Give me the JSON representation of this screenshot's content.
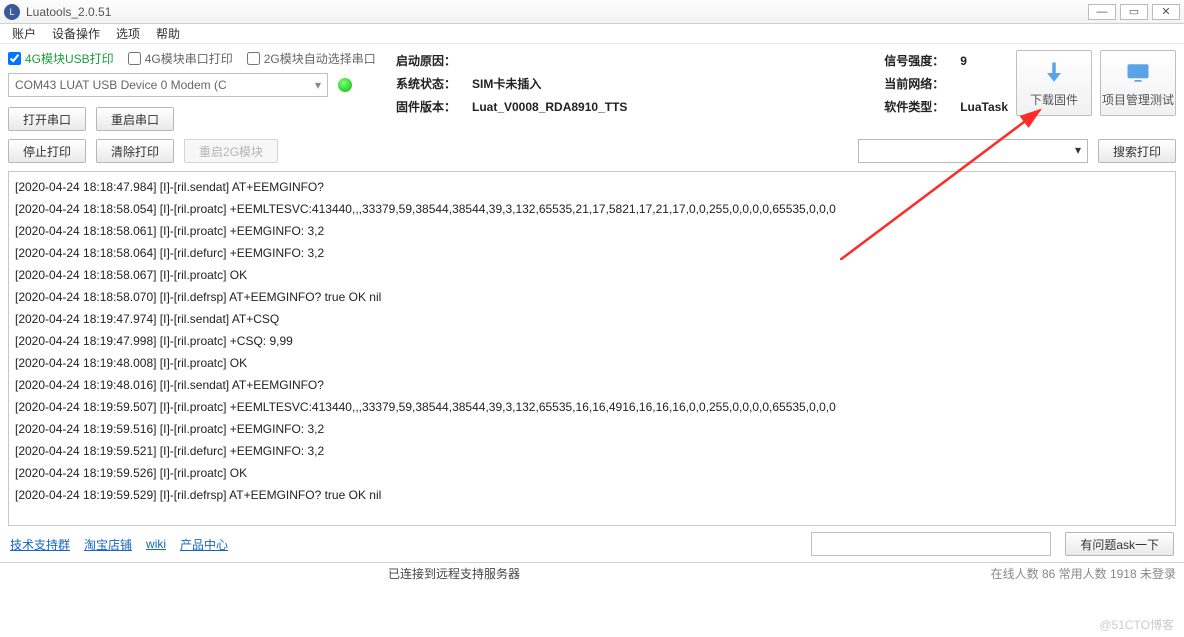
{
  "window": {
    "title": "Luatools_2.0.51"
  },
  "menu": {
    "account": "账户",
    "device": "设备操作",
    "options": "选项",
    "help": "帮助"
  },
  "checks": {
    "usb4g": "4G模块USB打印",
    "serial4g": "4G模块串口打印",
    "auto2g": "2G模块自动选择串口"
  },
  "combo": {
    "device": "COM43 LUAT USB Device 0 Modem (C"
  },
  "buttons": {
    "open_port": "打开串口",
    "restart_port": "重启串口",
    "stop_print": "停止打印",
    "clear_print": "清除打印",
    "restart_2g": "重启2G模块",
    "search_print": "搜索打印",
    "download_fw": "下载固件",
    "project_mgr": "项目管理测试",
    "ask": "有问题ask一下"
  },
  "info": {
    "boot_reason": {
      "label": "启动原因：",
      "value": ""
    },
    "sys_state": {
      "label": "系统状态：",
      "value": "SIM卡未插入"
    },
    "fw_version": {
      "label": "固件版本：",
      "value": "Luat_V0008_RDA8910_TTS"
    },
    "signal": {
      "label": "信号强度：",
      "value": "9"
    },
    "network": {
      "label": "当前网络：",
      "value": ""
    },
    "sw_type": {
      "label": "软件类型：",
      "value": "LuaTask"
    }
  },
  "log_lines": [
    "[2020-04-24 18:18:47.984] [I]-[ril.sendat] AT+EEMGINFO?",
    "[2020-04-24 18:18:58.054] [I]-[ril.proatc] +EEMLTESVC:413440,,,33379,59,38544,38544,39,3,132,65535,21,17,5821,17,21,17,0,0,255,0,0,0,0,65535,0,0,0",
    "[2020-04-24 18:18:58.061] [I]-[ril.proatc] +EEMGINFO: 3,2",
    "[2020-04-24 18:18:58.064] [I]-[ril.defurc] +EEMGINFO: 3,2",
    "[2020-04-24 18:18:58.067] [I]-[ril.proatc] OK",
    "[2020-04-24 18:18:58.070] [I]-[ril.defrsp] AT+EEMGINFO? true OK nil",
    "[2020-04-24 18:19:47.974] [I]-[ril.sendat] AT+CSQ",
    "[2020-04-24 18:19:47.998] [I]-[ril.proatc] +CSQ: 9,99",
    "[2020-04-24 18:19:48.008] [I]-[ril.proatc] OK",
    "[2020-04-24 18:19:48.016] [I]-[ril.sendat] AT+EEMGINFO?",
    "[2020-04-24 18:19:59.507] [I]-[ril.proatc] +EEMLTESVC:413440,,,33379,59,38544,38544,39,3,132,65535,16,16,4916,16,16,16,0,0,255,0,0,0,0,65535,0,0,0",
    "[2020-04-24 18:19:59.516] [I]-[ril.proatc] +EEMGINFO: 3,2",
    "[2020-04-24 18:19:59.521] [I]-[ril.defurc] +EEMGINFO: 3,2",
    "[2020-04-24 18:19:59.526] [I]-[ril.proatc] OK",
    "[2020-04-24 18:19:59.529] [I]-[ril.defrsp] AT+EEMGINFO? true OK nil"
  ],
  "links": {
    "tech_support": "技术支持群",
    "taobao": "淘宝店铺",
    "wiki": "wiki",
    "product": "产品中心"
  },
  "status": {
    "center": "已连接到远程支持服务器",
    "right": "在线人数 86 常用人数 1918 未登录"
  },
  "watermark": "@51CTO博客"
}
